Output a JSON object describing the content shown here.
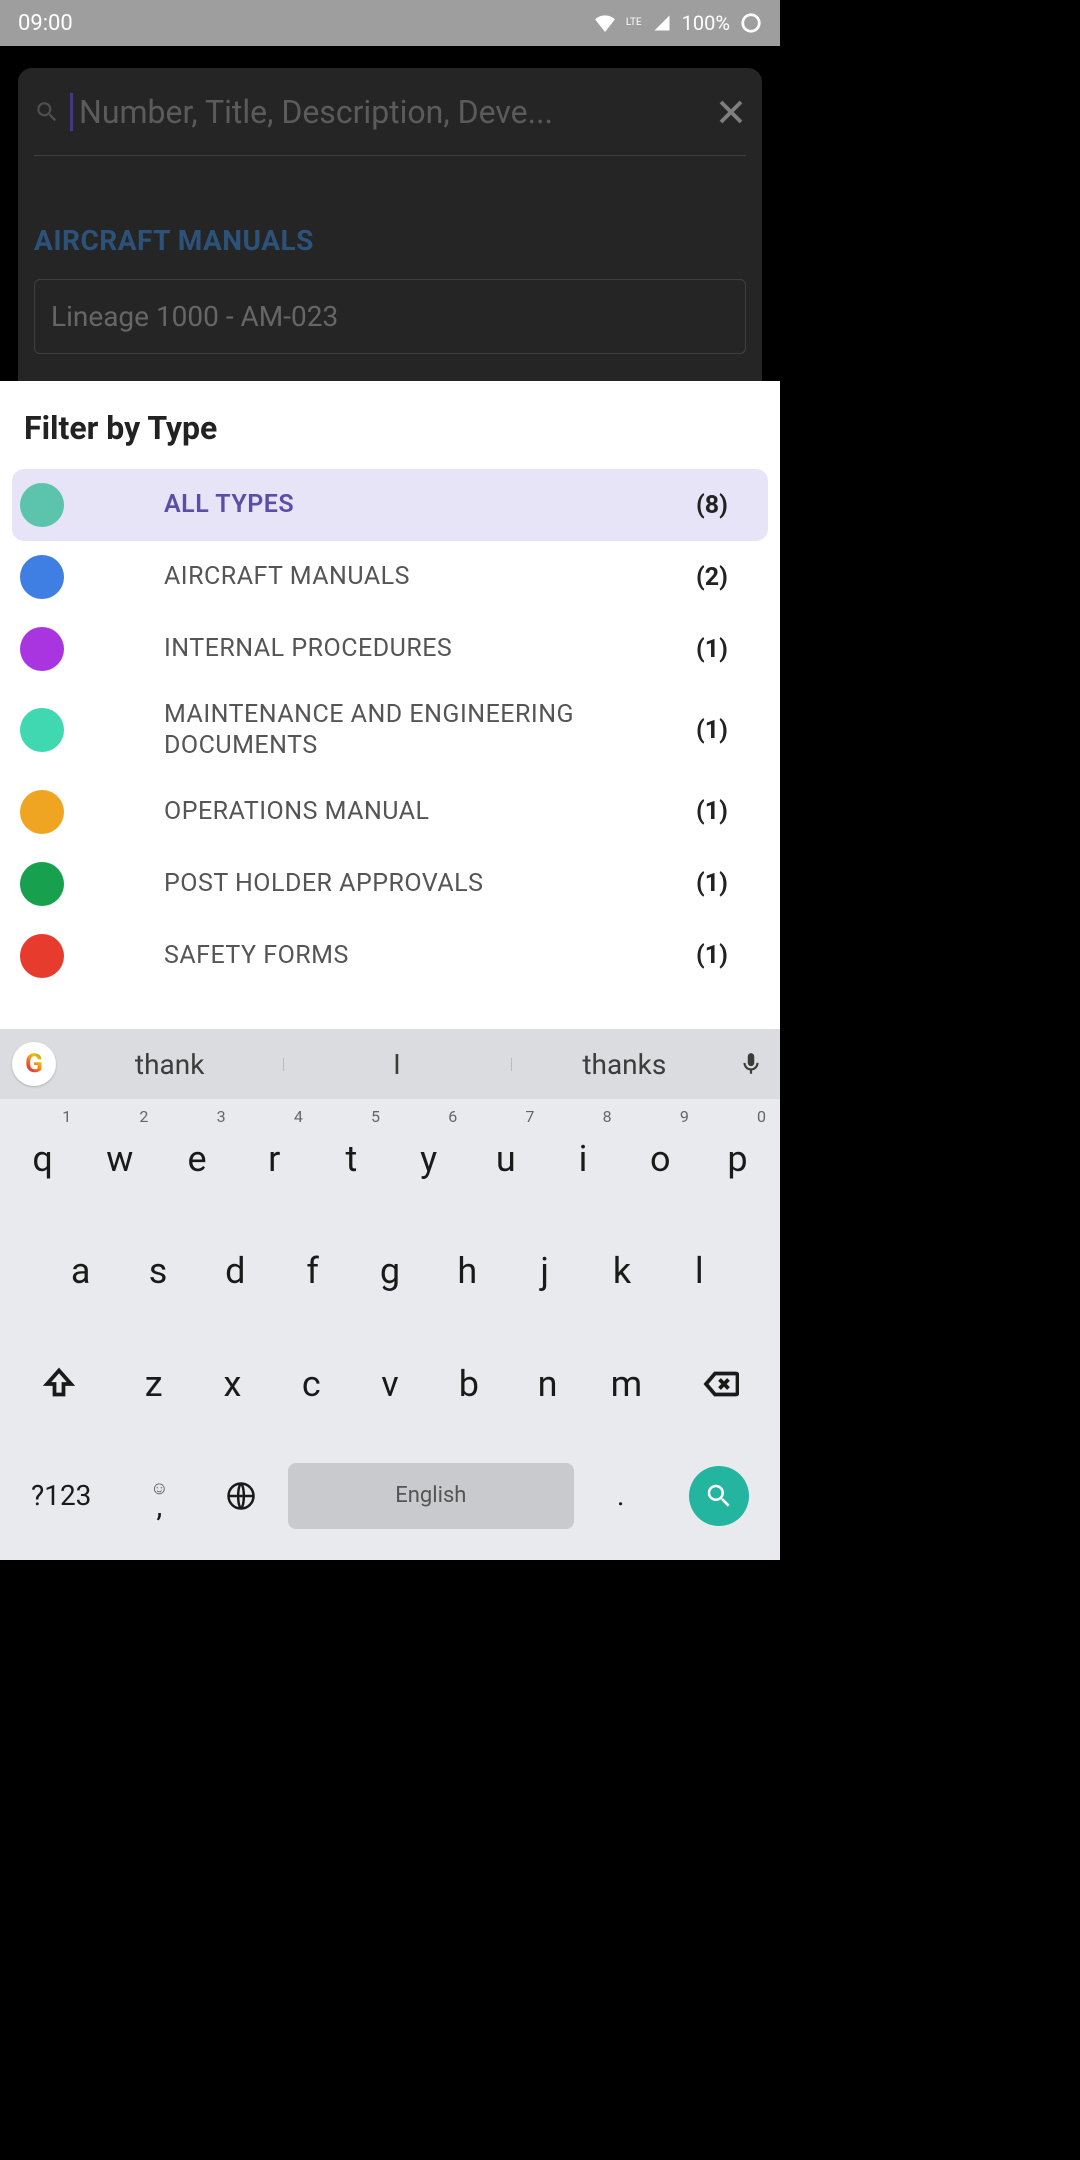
{
  "status": {
    "time": "09:00",
    "network": "LTE",
    "battery": "100%"
  },
  "search": {
    "placeholder": "Number, Title, Description, Deve..."
  },
  "section": {
    "title": "AIRCRAFT MANUALS",
    "item": "Lineage 1000 - AM-023"
  },
  "sheet": {
    "title": "Filter by Type",
    "filters": [
      {
        "label": "ALL TYPES",
        "count": "(8)",
        "color": "#5cc4ac",
        "selected": true
      },
      {
        "label": "AIRCRAFT MANUALS",
        "count": "(2)",
        "color": "#3f7ee2",
        "selected": false
      },
      {
        "label": "INTERNAL PROCEDURES",
        "count": "(1)",
        "color": "#a935e0",
        "selected": false
      },
      {
        "label": "MAINTENANCE AND ENGINEERING DOCUMENTS",
        "count": "(1)",
        "color": "#3fd8b0",
        "selected": false
      },
      {
        "label": "OPERATIONS MANUAL",
        "count": "(1)",
        "color": "#f0a522",
        "selected": false
      },
      {
        "label": "POST HOLDER APPROVALS",
        "count": "(1)",
        "color": "#17a04e",
        "selected": false
      },
      {
        "label": "SAFETY FORMS",
        "count": "(1)",
        "color": "#e73b2e",
        "selected": false
      }
    ]
  },
  "keyboard": {
    "suggestions": [
      "thank",
      "I",
      "thanks"
    ],
    "row1": [
      {
        "k": "q",
        "n": "1"
      },
      {
        "k": "w",
        "n": "2"
      },
      {
        "k": "e",
        "n": "3"
      },
      {
        "k": "r",
        "n": "4"
      },
      {
        "k": "t",
        "n": "5"
      },
      {
        "k": "y",
        "n": "6"
      },
      {
        "k": "u",
        "n": "7"
      },
      {
        "k": "i",
        "n": "8"
      },
      {
        "k": "o",
        "n": "9"
      },
      {
        "k": "p",
        "n": "0"
      }
    ],
    "row2": [
      "a",
      "s",
      "d",
      "f",
      "g",
      "h",
      "j",
      "k",
      "l"
    ],
    "row3": [
      "z",
      "x",
      "c",
      "v",
      "b",
      "n",
      "m"
    ],
    "symkey": "?123",
    "space": "English",
    "period": "."
  }
}
